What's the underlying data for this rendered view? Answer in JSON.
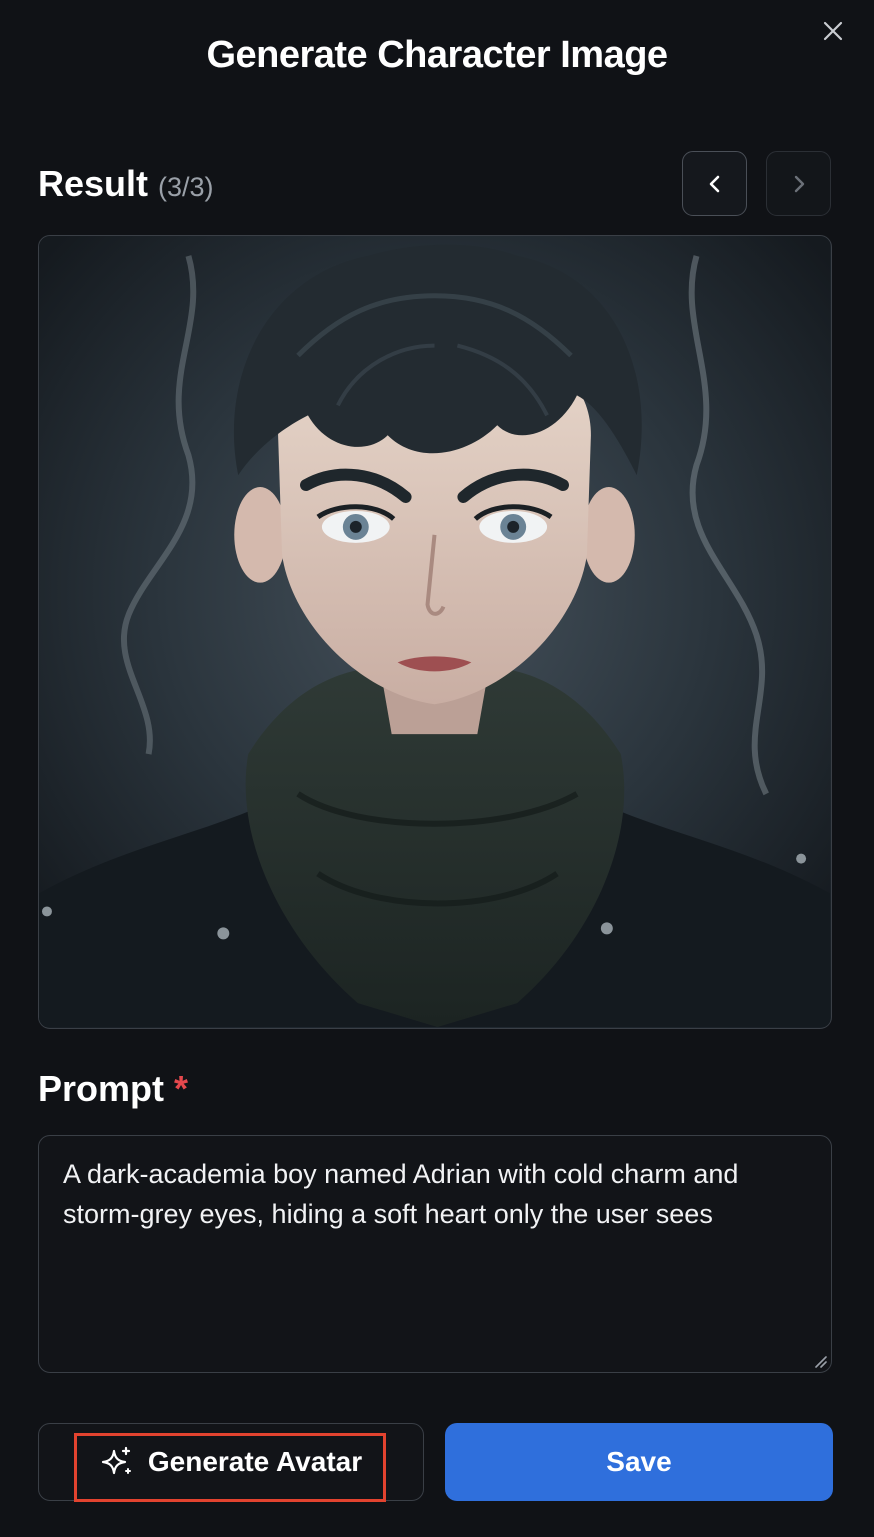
{
  "dialog": {
    "title": "Generate Character Image",
    "close_icon": "close-icon"
  },
  "result": {
    "heading": "Result",
    "counter": "(3/3)",
    "prev_icon": "chevron-left-icon",
    "next_icon": "chevron-right-icon",
    "image_description_icon": "character-portrait-image"
  },
  "prompt": {
    "label": "Prompt",
    "required_mark": "*",
    "value": "A dark-academia boy named Adrian with cold charm and storm-grey eyes, hiding a soft heart only the user sees"
  },
  "actions": {
    "generate_label": "Generate Avatar",
    "generate_icon": "sparkles-icon",
    "save_label": "Save"
  },
  "colors": {
    "background": "#101216",
    "accent": "#2f6fdc",
    "required": "#e5484d",
    "highlight": "#e2432f"
  }
}
